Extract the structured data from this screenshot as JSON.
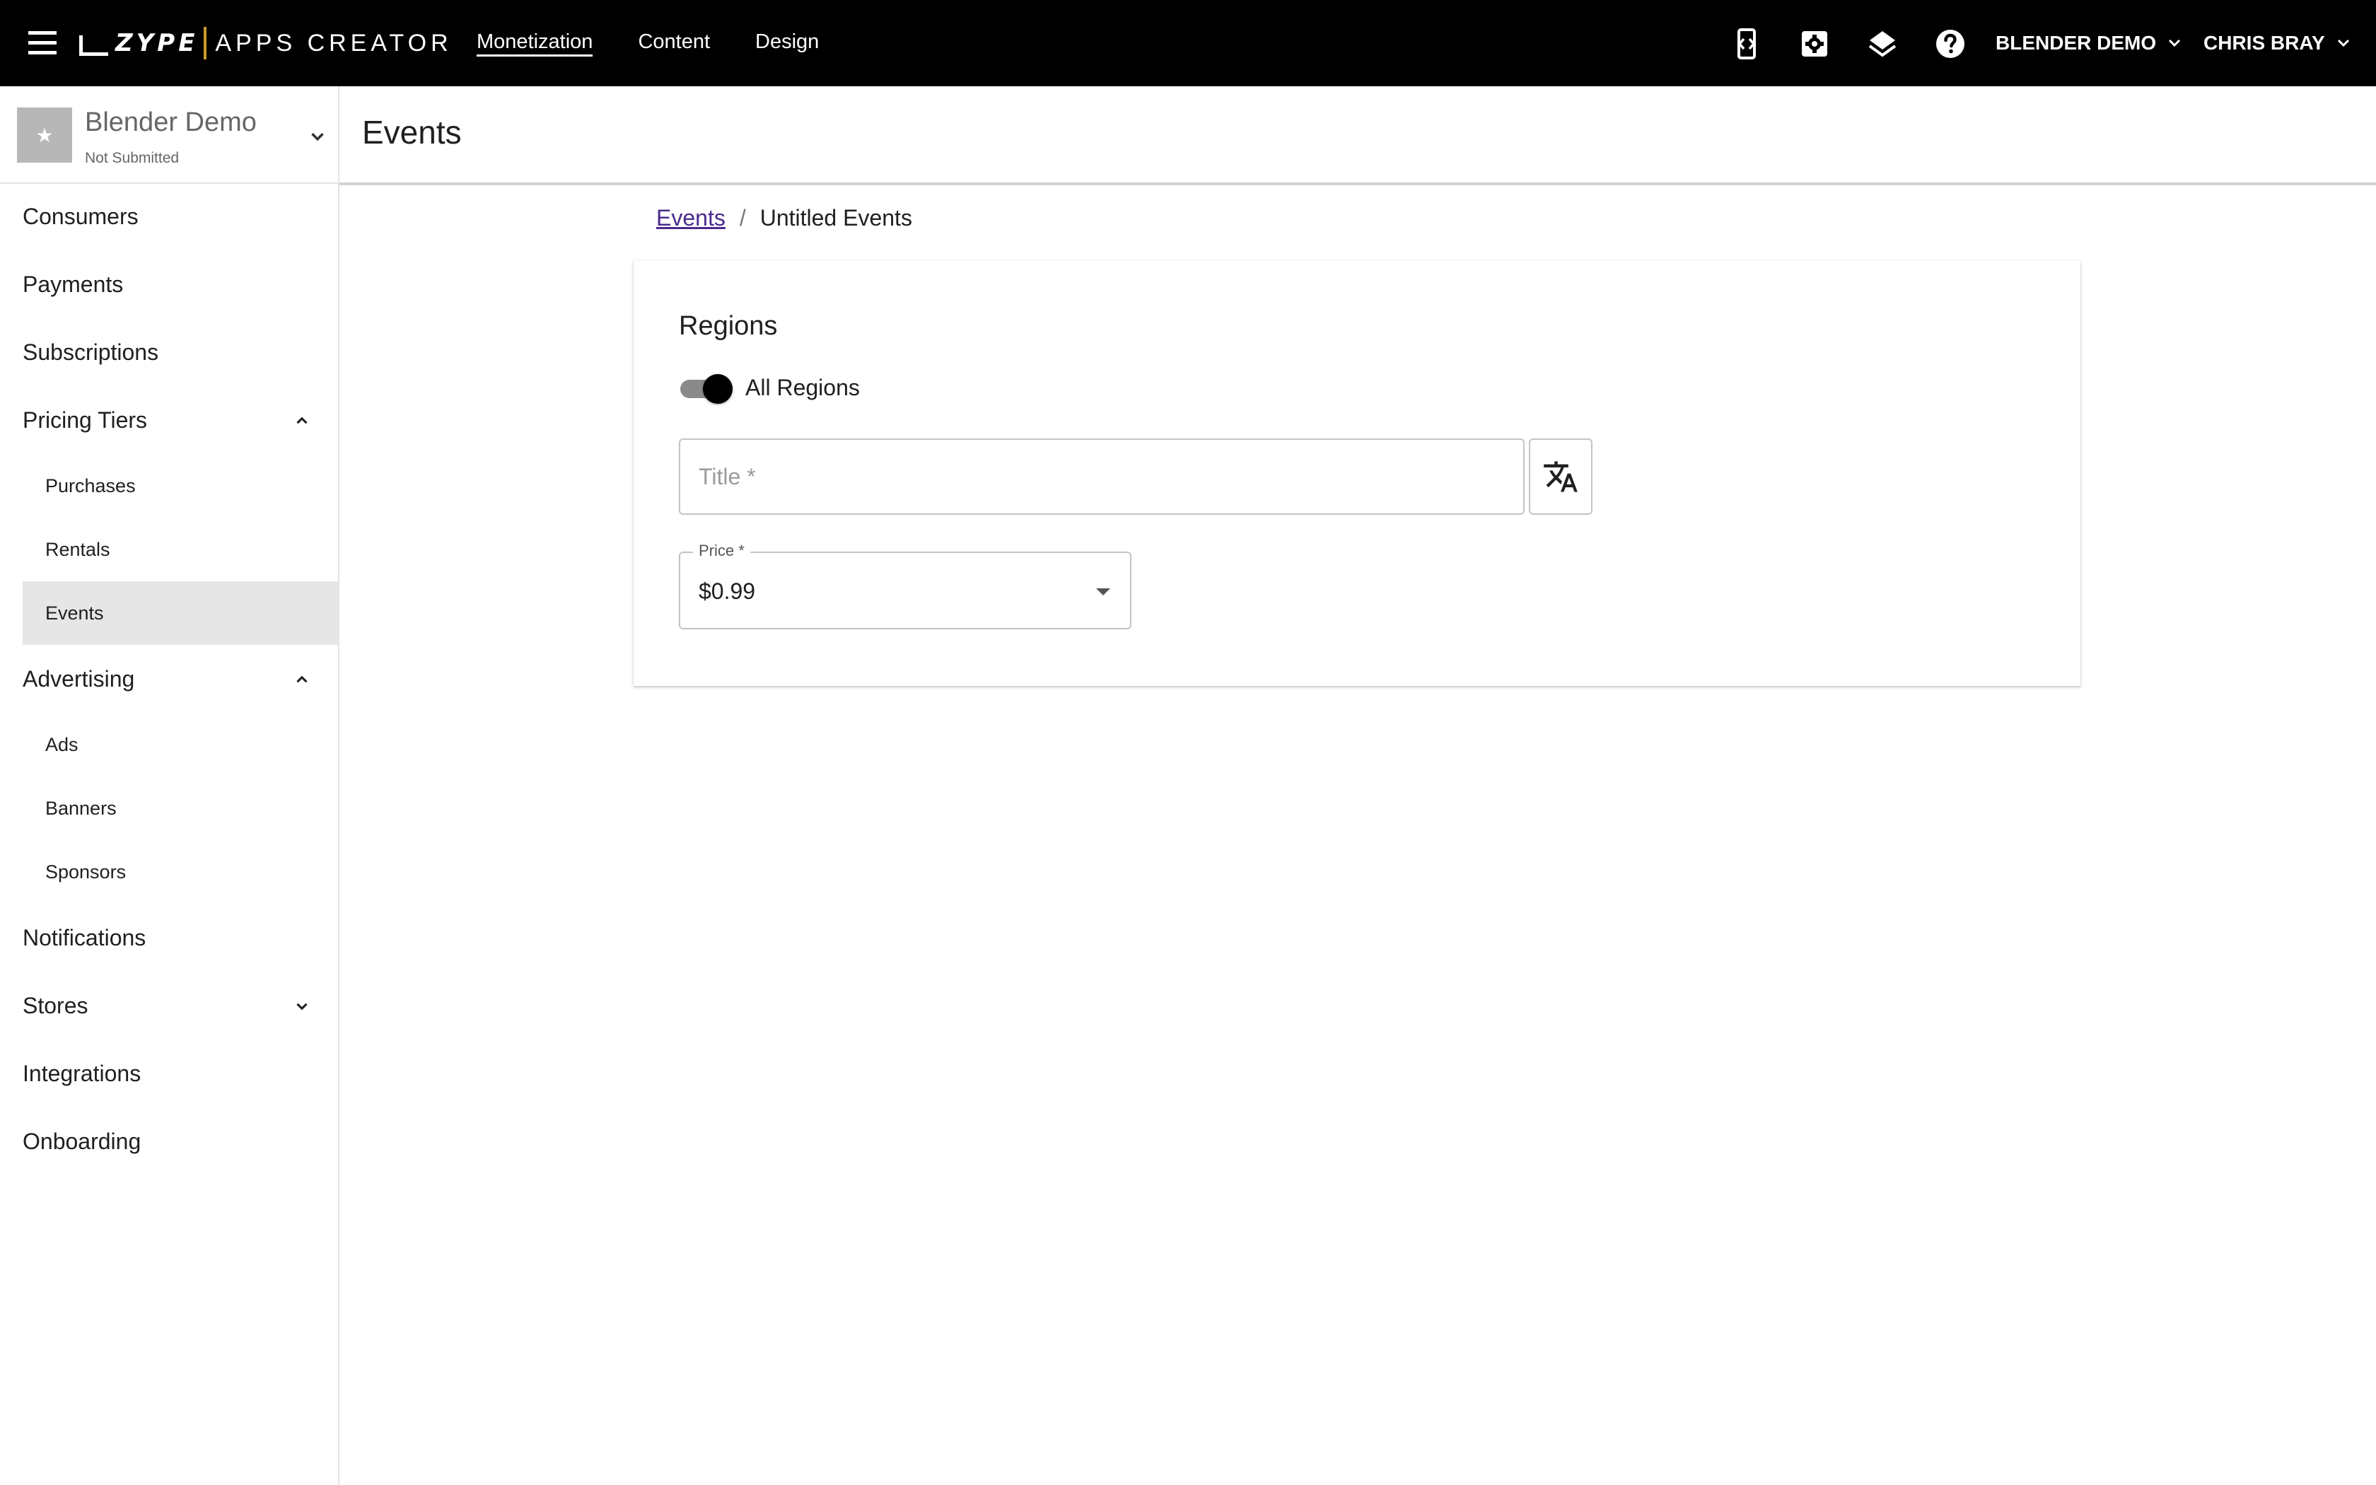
{
  "header": {
    "logo_wordmark": "ZYPE",
    "logo_product": "APPS CREATOR",
    "nav": [
      {
        "label": "Monetization",
        "active": true
      },
      {
        "label": "Content",
        "active": false
      },
      {
        "label": "Design",
        "active": false
      }
    ],
    "icons": [
      "mobile-code-icon",
      "settings-icon",
      "layers-icon",
      "help-icon"
    ],
    "app_menu_label": "BLENDER DEMO",
    "user_menu_label": "CHRIS BRAY"
  },
  "sidebar": {
    "app": {
      "name": "Blender Demo",
      "status": "Not Submitted",
      "thumbnail_icon": "star-icon"
    },
    "items": [
      {
        "label": "Consumers"
      },
      {
        "label": "Payments"
      },
      {
        "label": "Subscriptions"
      },
      {
        "label": "Pricing Tiers",
        "expanded": true,
        "children": [
          {
            "label": "Purchases"
          },
          {
            "label": "Rentals"
          },
          {
            "label": "Events",
            "selected": true
          }
        ]
      },
      {
        "label": "Advertising",
        "expanded": true,
        "children": [
          {
            "label": "Ads"
          },
          {
            "label": "Banners"
          },
          {
            "label": "Sponsors"
          }
        ]
      },
      {
        "label": "Notifications"
      },
      {
        "label": "Stores",
        "expanded": false
      },
      {
        "label": "Integrations"
      },
      {
        "label": "Onboarding"
      }
    ]
  },
  "main": {
    "page_title": "Events",
    "breadcrumb": {
      "parent": "Events",
      "separator": "/",
      "current": "Untitled Events"
    },
    "form": {
      "section_title": "Regions",
      "all_regions_label": "All Regions",
      "all_regions_on": true,
      "title_placeholder": "Title *",
      "title_value": "",
      "translate_icon": "translate-icon",
      "price_label": "Price *",
      "price_value": "$0.99"
    }
  },
  "colors": {
    "topbar_bg": "#000000",
    "logo_accent": "#c89a2c",
    "link": "#4a2a8c",
    "selected_nav_bg": "#e6e6e6"
  }
}
